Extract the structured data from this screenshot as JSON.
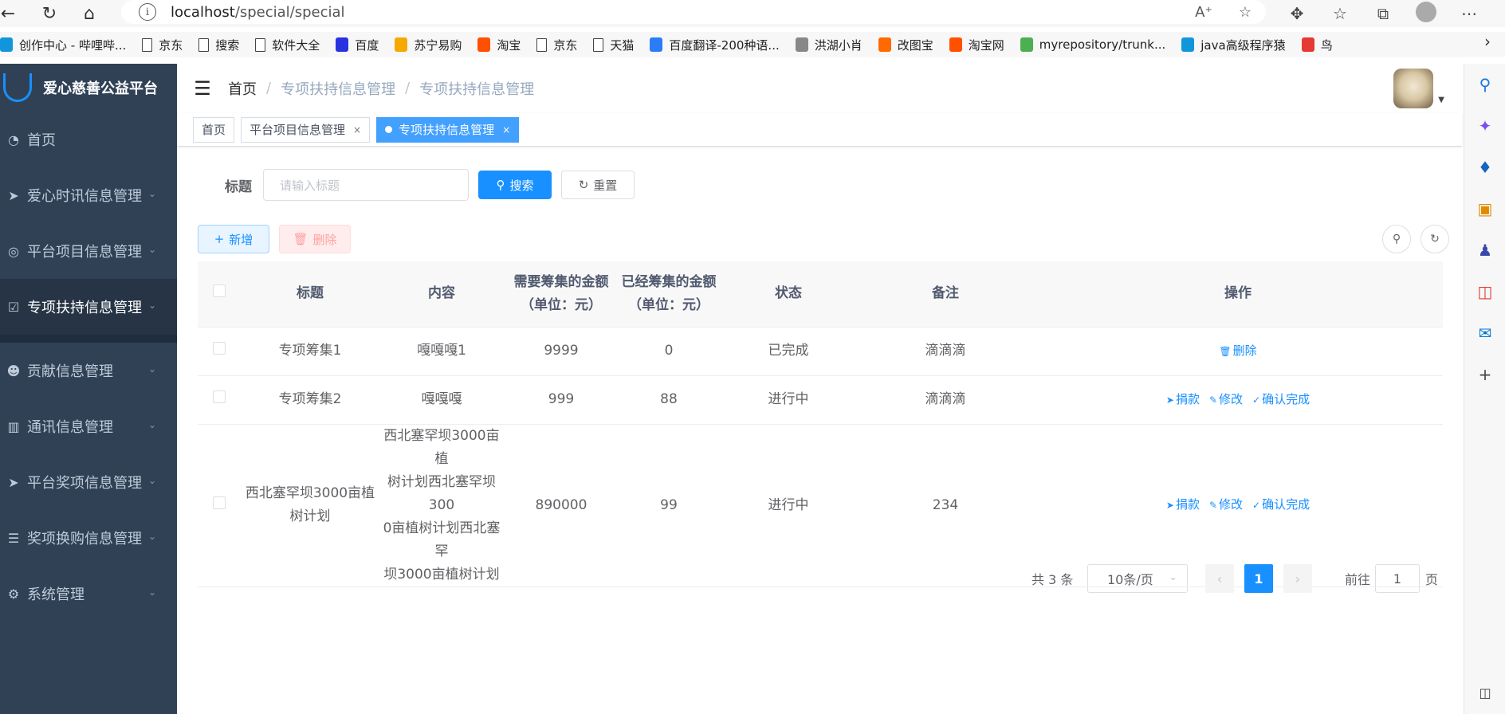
{
  "browser": {
    "url_host": "localhost",
    "url_path": "/special/special",
    "bookmarks": [
      {
        "label": "创作中心 - 哔哩哔...",
        "icon": "bilibili-icon",
        "color": "#1296db"
      },
      {
        "label": "京东",
        "icon": "document-icon"
      },
      {
        "label": "搜索",
        "icon": "document-icon"
      },
      {
        "label": "软件大全",
        "icon": "document-icon"
      },
      {
        "label": "百度",
        "icon": "baidu-icon",
        "color": "#2932e1"
      },
      {
        "label": "苏宁易购",
        "icon": "suning-icon",
        "color": "#f6a800"
      },
      {
        "label": "淘宝",
        "icon": "taobao-icon",
        "color": "#ff5000"
      },
      {
        "label": "京东",
        "icon": "document-icon"
      },
      {
        "label": "天猫",
        "icon": "document-icon"
      },
      {
        "label": "百度翻译-200种语...",
        "icon": "baidu-translate-icon",
        "color": "#2b7cf6"
      },
      {
        "label": "洪湖小肖",
        "icon": "bird-icon",
        "color": "#888888"
      },
      {
        "label": "改图宝",
        "icon": "gaitubao-icon",
        "color": "#ff6a00"
      },
      {
        "label": "淘宝网",
        "icon": "taobao-icon",
        "color": "#ff5000"
      },
      {
        "label": "myrepository/trunk...",
        "icon": "chrome-icon",
        "color": "#4caf50"
      },
      {
        "label": "java高级程序猿",
        "icon": "bilibili-icon",
        "color": "#1296db"
      },
      {
        "label": "鸟",
        "icon": "bird-icon",
        "color": "#e53935"
      }
    ]
  },
  "app": {
    "title": "爱心慈善公益平台",
    "accent": "#1890ff",
    "sidebar_bg": "#304156"
  },
  "sidebar": {
    "items": [
      {
        "label": "首页",
        "icon": "dashboard-icon",
        "has_arrow": false
      },
      {
        "label": "爱心时讯信息管理",
        "icon": "send-icon",
        "has_arrow": true
      },
      {
        "label": "平台项目信息管理",
        "icon": "chrome-icon",
        "has_arrow": true
      },
      {
        "label": "专项扶持信息管理",
        "icon": "chart-icon",
        "has_arrow": true,
        "active": true
      },
      {
        "label": "贡献信息管理",
        "icon": "peoples-icon",
        "has_arrow": true
      },
      {
        "label": "通讯信息管理",
        "icon": "book-icon",
        "has_arrow": true
      },
      {
        "label": "平台奖项信息管理",
        "icon": "send-icon",
        "has_arrow": true
      },
      {
        "label": "奖项换购信息管理",
        "icon": "cart-icon",
        "has_arrow": true
      },
      {
        "label": "系统管理",
        "icon": "gear-icon",
        "has_arrow": true
      }
    ]
  },
  "breadcrumb": [
    "首页",
    "专项扶持信息管理",
    "专项扶持信息管理"
  ],
  "tags": [
    {
      "label": "首页",
      "closable": false,
      "active": false
    },
    {
      "label": "平台项目信息管理",
      "closable": true,
      "active": false
    },
    {
      "label": "专项扶持信息管理",
      "closable": true,
      "active": true
    }
  ],
  "search": {
    "label": "标题",
    "placeholder": "请输入标题",
    "search_btn": "搜索",
    "reset_btn": "重置"
  },
  "toolbar": {
    "add_label": "新增",
    "delete_label": "删除"
  },
  "table": {
    "columns": [
      "标题",
      "内容",
      "需要筹集的金额（单位：元）",
      "已经筹集的金额（单位：元）",
      "状态",
      "备注",
      "操作"
    ],
    "column_lines": [
      [
        "标题"
      ],
      [
        "内容"
      ],
      [
        "需要筹集的金额",
        "（单位：元）"
      ],
      [
        "已经筹集的金额",
        "（单位：元）"
      ],
      [
        "状态"
      ],
      [
        "备注"
      ],
      [
        "操作"
      ]
    ],
    "rows": [
      {
        "title": [
          "专项筹集1"
        ],
        "content": [
          "嘎嘎嘎1"
        ],
        "need": "9999",
        "raised": "0",
        "status": "已完成",
        "remark": "滴滴滴",
        "ops": [
          "删除"
        ]
      },
      {
        "title": [
          "专项筹集2"
        ],
        "content": [
          "嘎嘎嘎"
        ],
        "need": "999",
        "raised": "88",
        "status": "进行中",
        "remark": "滴滴滴",
        "ops": [
          "捐款",
          "修改",
          "确认完成"
        ]
      },
      {
        "title": [
          "西北塞罕坝3000亩植",
          "树计划"
        ],
        "content": [
          "西北塞罕坝3000亩植",
          "树计划西北塞罕坝300",
          "0亩植树计划西北塞罕",
          "坝3000亩植树计划"
        ],
        "need": "890000",
        "raised": "99",
        "status": "进行中",
        "remark": "234",
        "ops": [
          "捐款",
          "修改",
          "确认完成"
        ]
      }
    ]
  },
  "pagination": {
    "total_text": "共 3 条",
    "page_size": "10条/页",
    "current_page": "1",
    "goto_label": "前往",
    "goto_value": "1",
    "page_unit": "页"
  }
}
